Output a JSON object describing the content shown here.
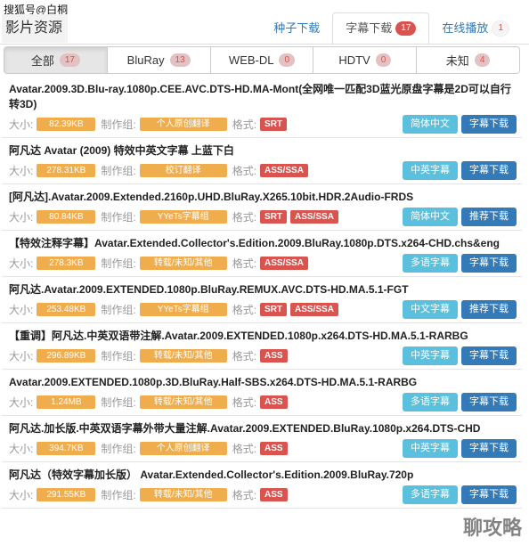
{
  "watermark": "搜狐号@白桐",
  "section_title": "影片资源",
  "main_tabs": [
    {
      "label": "种子下载",
      "badge": ""
    },
    {
      "label": "字幕下载",
      "badge": "17"
    },
    {
      "label": "在线播放",
      "badge": "1"
    }
  ],
  "filters": [
    {
      "label": "全部",
      "count": "17"
    },
    {
      "label": "BluRay",
      "count": "13"
    },
    {
      "label": "WEB-DL",
      "count": "0"
    },
    {
      "label": "HDTV",
      "count": "0"
    },
    {
      "label": "未知",
      "count": "4"
    }
  ],
  "labels": {
    "size": "大小:",
    "group": "制作组:",
    "format": "格式:"
  },
  "items": [
    {
      "title": "Avatar.2009.3D.Blu-ray.1080p.CEE.AVC.DTS-HD.MA-Mont(全网唯一匹配3D蓝光原盘字幕是2D可以自行转3D)",
      "size": "82.39KB",
      "group": "个人原创翻译",
      "formats": [
        "SRT"
      ],
      "btn1": "简体中文",
      "btn2": "字幕下载"
    },
    {
      "title": "阿凡达 Avatar (2009) 特效中英文字幕 上蓝下白",
      "size": "278.31KB",
      "group": "校订翻译",
      "formats": [
        "ASS/SSA"
      ],
      "btn1": "中英字幕",
      "btn2": "字幕下载"
    },
    {
      "title": "[阿凡达].Avatar.2009.Extended.2160p.UHD.BluRay.X265.10bit.HDR.2Audio-FRDS",
      "size": "80.84KB",
      "group": "YYeTs字幕组",
      "formats": [
        "SRT",
        "ASS/SSA"
      ],
      "btn1": "简体中文",
      "btn2": "推荐下载"
    },
    {
      "title": "【特效注释字幕】Avatar.Extended.Collector's.Edition.2009.BluRay.1080p.DTS.x264-CHD.chs&eng",
      "size": "278.3KB",
      "group": "转载/未知/其他",
      "formats": [
        "ASS/SSA"
      ],
      "btn1": "多语字幕",
      "btn2": "字幕下载"
    },
    {
      "title": "阿凡达.Avatar.2009.EXTENDED.1080p.BluRay.REMUX.AVC.DTS-HD.MA.5.1-FGT",
      "size": "253.48KB",
      "group": "YYeTs字幕组",
      "formats": [
        "SRT",
        "ASS/SSA"
      ],
      "btn1": "中文字幕",
      "btn2": "推荐下载"
    },
    {
      "title": "【重调】阿凡达.中英双语带注解.Avatar.2009.EXTENDED.1080p.x264.DTS-HD.MA.5.1-RARBG",
      "size": "296.89KB",
      "group": "转载/未知/其他",
      "formats": [
        "ASS"
      ],
      "btn1": "中英字幕",
      "btn2": "字幕下载"
    },
    {
      "title": "Avatar.2009.EXTENDED.1080p.3D.BluRay.Half-SBS.x264.DTS-HD.MA.5.1-RARBG",
      "size": "1.24MB",
      "group": "转载/未知/其他",
      "formats": [
        "ASS"
      ],
      "btn1": "多语字幕",
      "btn2": "字幕下载"
    },
    {
      "title": "阿凡达.加长版.中英双语字幕外带大量注解.Avatar.2009.EXTENDED.BluRay.1080p.x264.DTS-CHD",
      "size": "394.7KB",
      "group": "个人原创翻译",
      "formats": [
        "ASS"
      ],
      "btn1": "中英字幕",
      "btn2": "字幕下载"
    },
    {
      "title": "阿凡达（特效字幕加长版） Avatar.Extended.Collector's.Edition.2009.BluRay.720p",
      "size": "291.55KB",
      "group": "转载/未知/其他",
      "formats": [
        "ASS"
      ],
      "btn1": "多语字幕",
      "btn2": "字幕下载"
    }
  ],
  "corner_watermark": "聊攻略"
}
